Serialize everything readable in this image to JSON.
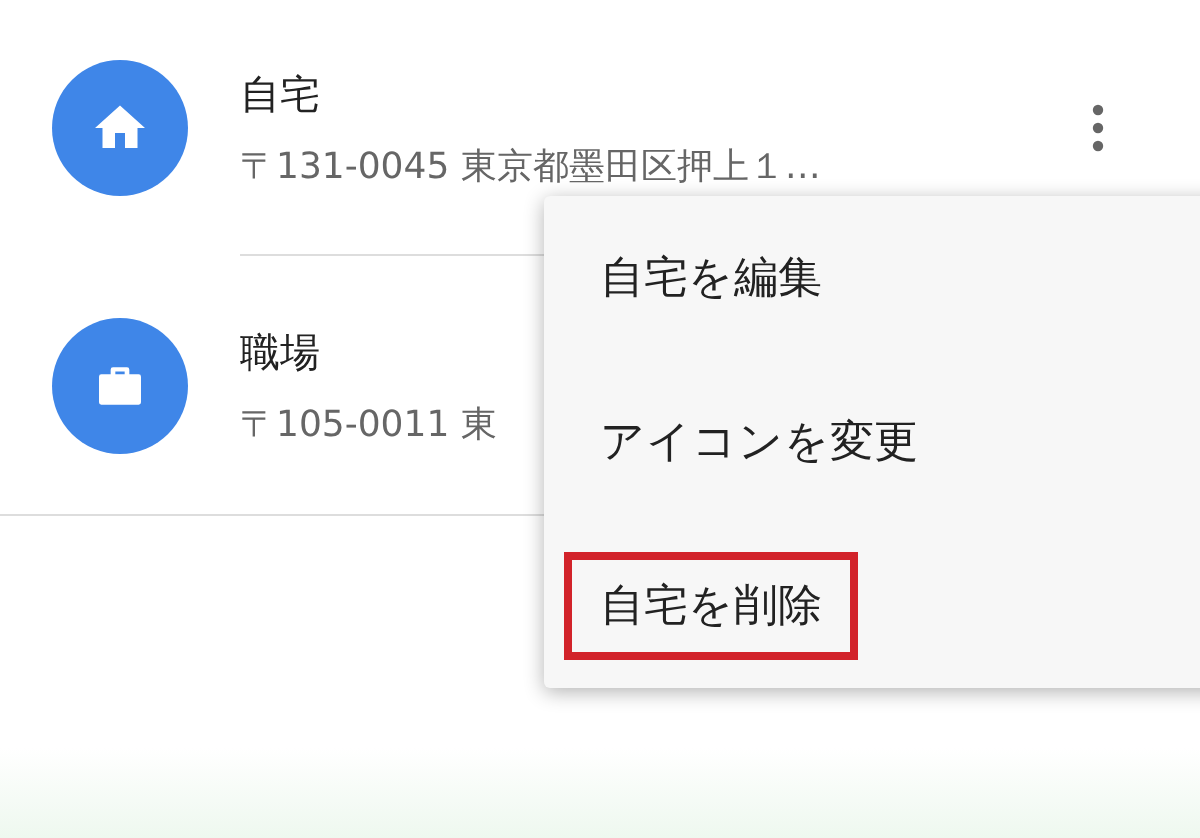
{
  "places": [
    {
      "kind": "home",
      "title": "自宅",
      "address": "〒131-0045 東京都墨田区押上１…",
      "has_menu_button": true
    },
    {
      "kind": "work",
      "title": "職場",
      "address": "〒105-0011 東"
    }
  ],
  "menu": {
    "items": [
      {
        "label": "自宅を編集",
        "highlighted": false
      },
      {
        "label": "アイコンを変更",
        "highlighted": false
      },
      {
        "label": "自宅を削除",
        "highlighted": true
      }
    ]
  }
}
